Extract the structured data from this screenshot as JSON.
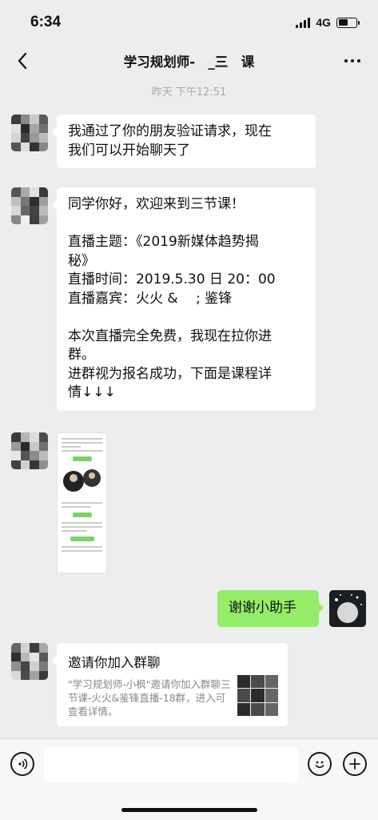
{
  "status_bar": {
    "time": "6:34",
    "network": "4G",
    "battery_level": 0.55
  },
  "nav": {
    "title": "学习规划师-　_三　课"
  },
  "timestamp": "昨天 下午12:51",
  "messages": [
    {
      "sender": "assistant",
      "text": "我通过了你的朋友验证请求，现在\n我们可以开始聊天了"
    },
    {
      "sender": "assistant",
      "text": "同学你好，欢迎来到三节课！\n\n直播主题：《2019新媒体趋势揭\n秘》\n直播时间：2019.5.30 日 20：00\n直播嘉宾：火火 &　 ; 鉴锋\n\n本次直播完全免费，我现在拉你进\n群。\n进群视为报名成功，下面是课程详\n情↓↓↓"
    },
    {
      "sender": "assistant",
      "type": "image"
    },
    {
      "sender": "me",
      "text": "谢谢小助手"
    },
    {
      "sender": "assistant",
      "type": "group-invite",
      "title": "邀请你加入群聊",
      "description": "\"学习规划师-小枫\"邀请你加入群聊三节课-火火&鉴锋直播-18群，进入可查看详情。"
    }
  ],
  "input": {
    "placeholder": ""
  },
  "icons": {
    "back": "chevron-left-icon",
    "more": "more-dots-icon",
    "voice": "voice-icon",
    "emoji": "emoji-icon",
    "plus": "plus-icon"
  },
  "colors": {
    "background": "#ededed",
    "my_bubble": "#95ec69",
    "their_bubble": "#ffffff"
  }
}
